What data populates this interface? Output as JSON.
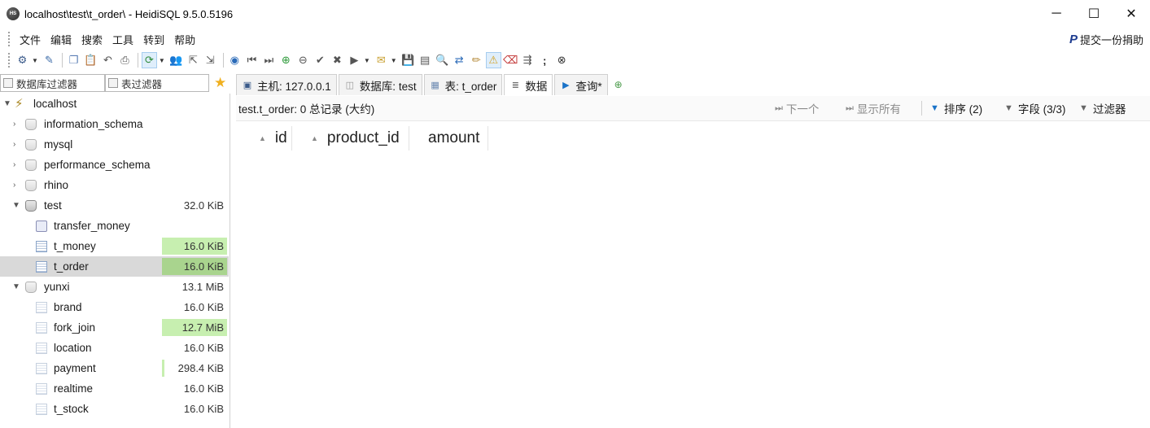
{
  "window": {
    "title": "localhost\\test\\t_order\\ - HeidiSQL 9.5.0.5196",
    "app_icon_label": "HS",
    "controls": [
      "─",
      "☐",
      "✕"
    ]
  },
  "menu": {
    "items": [
      "文件",
      "编辑",
      "搜索",
      "工具",
      "转到",
      "帮助"
    ],
    "donate": "提交一份捐助"
  },
  "toolbar": {
    "icons": [
      "connect-icon",
      "dropdown",
      "disconnect-icon",
      "copy-icon",
      "paste-icon",
      "undo-icon",
      "print-icon",
      "refresh-icon",
      "dropdown",
      "user-manager-icon",
      "export-icon",
      "import-icon",
      "help-icon",
      "first-icon",
      "last-icon",
      "insert-row-icon",
      "delete-row-icon",
      "post-icon",
      "cancel-icon",
      "run-icon",
      "dropdown",
      "explain-icon",
      "dropdown",
      "save-icon",
      "load-icon",
      "find-icon",
      "replace-icon",
      "edit-icon",
      "warning-icon",
      "clear-icon",
      "stop-icon",
      "semicolon-icon",
      "close-icon"
    ]
  },
  "filters": {
    "db_filter": "数据库过滤器",
    "table_filter": "表过滤器"
  },
  "tree": {
    "host": "localhost",
    "databases": [
      {
        "name": "information_schema",
        "size": ""
      },
      {
        "name": "mysql",
        "size": ""
      },
      {
        "name": "performance_schema",
        "size": ""
      },
      {
        "name": "rhino",
        "size": ""
      },
      {
        "name": "test",
        "size": "32.0 KiB"
      },
      {
        "name": "transfer_money",
        "size": ""
      },
      {
        "name": "t_money",
        "size": "16.0 KiB"
      },
      {
        "name": "t_order",
        "size": "16.0 KiB"
      },
      {
        "name": "yunxi",
        "size": "13.1 MiB"
      },
      {
        "name": "brand",
        "size": "16.0 KiB"
      },
      {
        "name": "fork_join",
        "size": "12.7 MiB"
      },
      {
        "name": "location",
        "size": "16.0 KiB"
      },
      {
        "name": "payment",
        "size": "298.4 KiB"
      },
      {
        "name": "realtime",
        "size": "16.0 KiB"
      },
      {
        "name": "t_stock",
        "size": "16.0 KiB"
      }
    ]
  },
  "tabs": {
    "host": "主机: 127.0.0.1",
    "database": "数据库: test",
    "table": "表: t_order",
    "data": "数据",
    "query": "查询*"
  },
  "grid": {
    "status": "test.t_order: 0 总记录 (大约)",
    "next": "下一个",
    "show_all": "显示所有",
    "sort": "排序 (2)",
    "columns_ctrl": "字段 (3/3)",
    "filter": "过滤器",
    "columns": [
      "id",
      "product_id",
      "amount"
    ]
  },
  "colors": {
    "size_bar_green": "#c7efb0",
    "selected_row": "#d9d9d9",
    "active_tab_accent": "#1a73c8"
  }
}
